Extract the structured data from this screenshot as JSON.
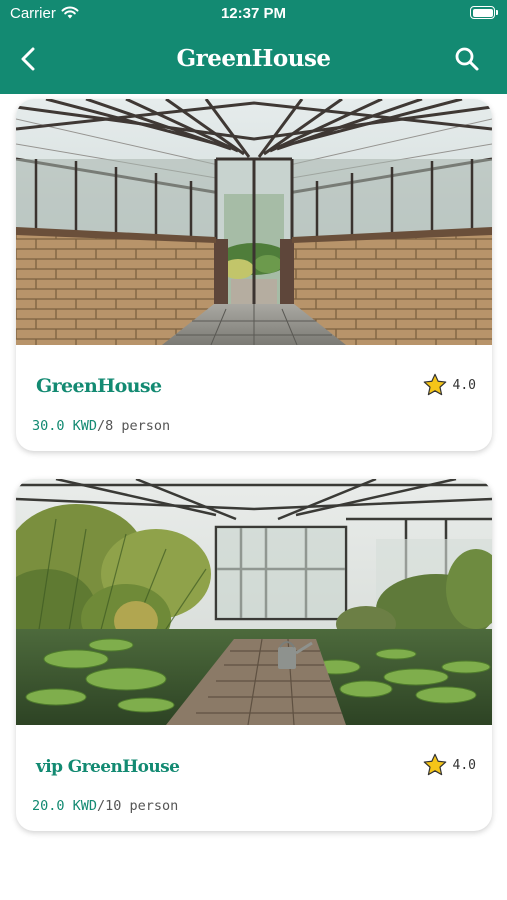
{
  "status_bar": {
    "carrier": "Carrier",
    "time": "12:37 PM"
  },
  "nav": {
    "title": "GreenHouse"
  },
  "colors": {
    "primary": "#138a72",
    "star": "#f5c518",
    "text_muted": "#555555"
  },
  "icons": {
    "back": "chevron-left-icon",
    "search": "search-icon",
    "rating": "star-icon"
  },
  "listings": [
    {
      "title": "GreenHouse",
      "rating": "4.0",
      "price": "30.0 KWD",
      "capacity": "/8 person"
    },
    {
      "title": "vip GreenHouse",
      "rating": "4.0",
      "price": "20.0 KWD",
      "capacity": "/10 person"
    }
  ]
}
